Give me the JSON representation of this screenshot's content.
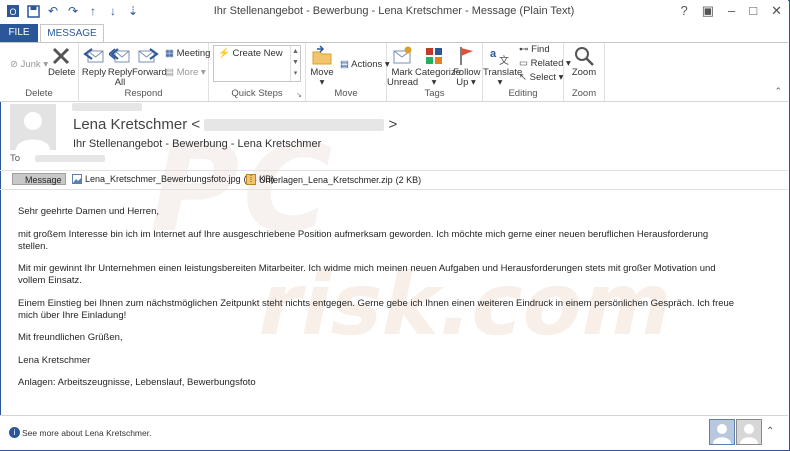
{
  "window": {
    "title": "Ihr Stellenangebot - Bewerbung - Lena Kretschmer - Message (Plain Text)",
    "controls": [
      "?",
      "▣",
      "–",
      "□",
      "✕"
    ]
  },
  "tabs": {
    "file": "FILE",
    "message": "MESSAGE"
  },
  "ribbon": {
    "delete_group": {
      "junk": "Junk",
      "delete": "Delete",
      "label": "Delete"
    },
    "respond_group": {
      "reply": "Reply",
      "reply_all_1": "Reply",
      "reply_all_2": "All",
      "forward": "Forward",
      "meeting": "Meeting",
      "more": "More",
      "label": "Respond"
    },
    "quick_steps": {
      "create_new": "Create New",
      "label": "Quick Steps"
    },
    "move_group": {
      "move": "Move",
      "actions": "Actions",
      "label": "Move"
    },
    "tags_group": {
      "mark_unread_1": "Mark",
      "mark_unread_2": "Unread",
      "categorize": "Categorize",
      "follow_up_1": "Follow",
      "follow_up_2": "Up",
      "label": "Tags"
    },
    "editing_group": {
      "translate": "Translate",
      "find": "Find",
      "related": "Related",
      "select": "Select",
      "label": "Editing"
    },
    "zoom_group": {
      "zoom": "Zoom",
      "label": "Zoom"
    }
  },
  "header": {
    "sender_name": "Lena Kretschmer",
    "subject": "Ihr Stellenangebot - Bewerbung - Lena Kretschmer",
    "to_label": "To"
  },
  "attachments": {
    "message_tab": "Message",
    "items": [
      {
        "name": "Lena_Kretschmer_Bewerbungsfoto.jpg",
        "size": "(13 KB)"
      },
      {
        "name": "Unterlagen_Lena_Kretschmer.zip",
        "size": "(2 KB)"
      }
    ]
  },
  "body": {
    "p1": "Sehr geehrte Damen und Herren,",
    "p2": "mit großem Interesse bin ich im Internet auf Ihre ausgeschriebene Position aufmerksam geworden. Ich möchte mich gerne einer neuen beruflichen Herausforderung stellen.",
    "p3": "Mit mir gewinnt Ihr Unternehmen einen leistungsbereiten Mitarbeiter. Ich widme mich meinen neuen Aufgaben und Herausforderungen stets mit großer Motivation und vollem Einsatz.",
    "p4": "Einem Einstieg bei Ihnen zum nächstmöglichen Zeitpunkt steht nichts entgegen. Gerne gebe ich Ihnen einen weiteren Eindruck in einem persönlichen Gespräch. Ich freue mich über Ihre Einladung!",
    "p5": "Mit freundlichen Grüßen,",
    "p6": "Lena Kretschmer",
    "p7": "Anlagen: Arbeitszeugnisse, Lebenslauf, Bewerbungsfoto"
  },
  "watermark": {
    "line1": "PC",
    "line2": "risk.com"
  },
  "footer": {
    "people_pane": "See more about Lena Kretschmer."
  },
  "colors": {
    "accent": "#2b579a",
    "file_tab": "#2b579a"
  }
}
